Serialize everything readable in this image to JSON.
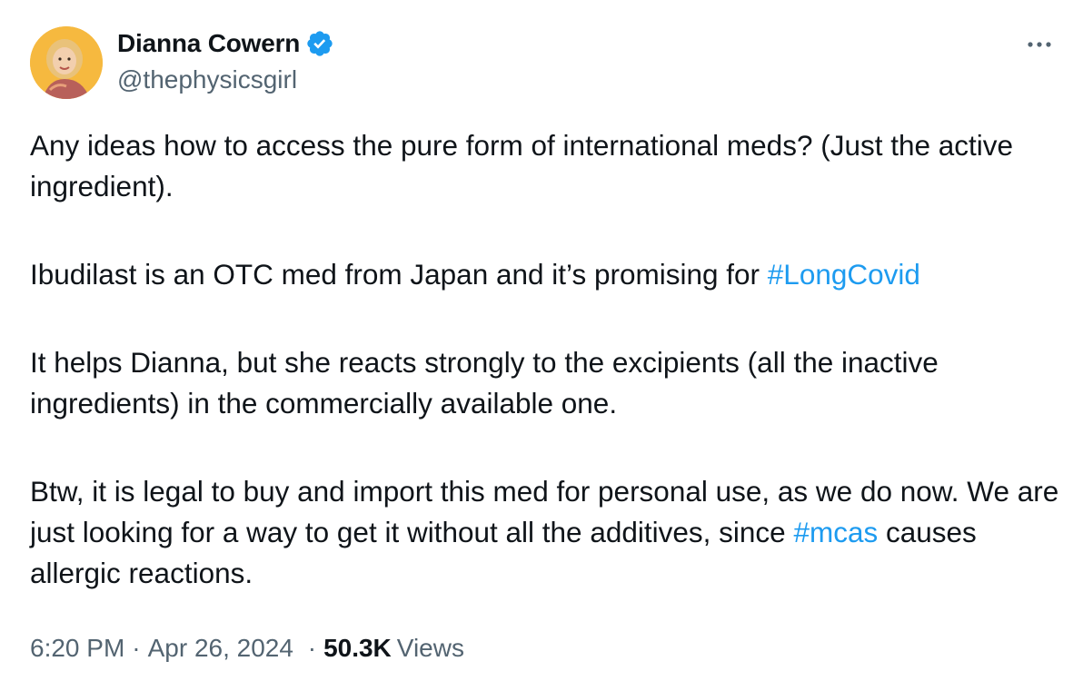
{
  "author": {
    "display_name": "Dianna Cowern",
    "handle": "@thephysicsgirl",
    "verified": true,
    "avatar_icon": "profile-photo"
  },
  "menu": {
    "more_icon": "more-horizontal-icon"
  },
  "tweet": {
    "paragraphs": [
      {
        "segments": [
          {
            "text": "Any ideas how to access the pure form of international meds? (Just the active ingredient).",
            "hashtag": false
          }
        ]
      },
      {
        "segments": [
          {
            "text": "Ibudilast is an OTC med from Japan and it’s promising for ",
            "hashtag": false
          },
          {
            "text": "#LongCovid",
            "hashtag": true
          }
        ]
      },
      {
        "segments": [
          {
            "text": "It helps Dianna, but she reacts strongly to the excipients (all the inactive ingredients) in the commercially available one.",
            "hashtag": false
          }
        ]
      },
      {
        "segments": [
          {
            "text": "Btw, it is legal to buy and import this med for personal use, as we do now. We are just looking for a way to get it without all the additives, since ",
            "hashtag": false
          },
          {
            "text": "#mcas",
            "hashtag": true
          },
          {
            "text": " causes allergic reactions.",
            "hashtag": false
          }
        ]
      }
    ]
  },
  "meta": {
    "time": "6:20 PM",
    "separator": "·",
    "date": "Apr 26, 2024",
    "views_count": "50.3K",
    "views_label": "Views"
  },
  "colors": {
    "text": "#0f1419",
    "secondary": "#536471",
    "link": "#1d9bf0",
    "verified": "#1d9bf0"
  }
}
